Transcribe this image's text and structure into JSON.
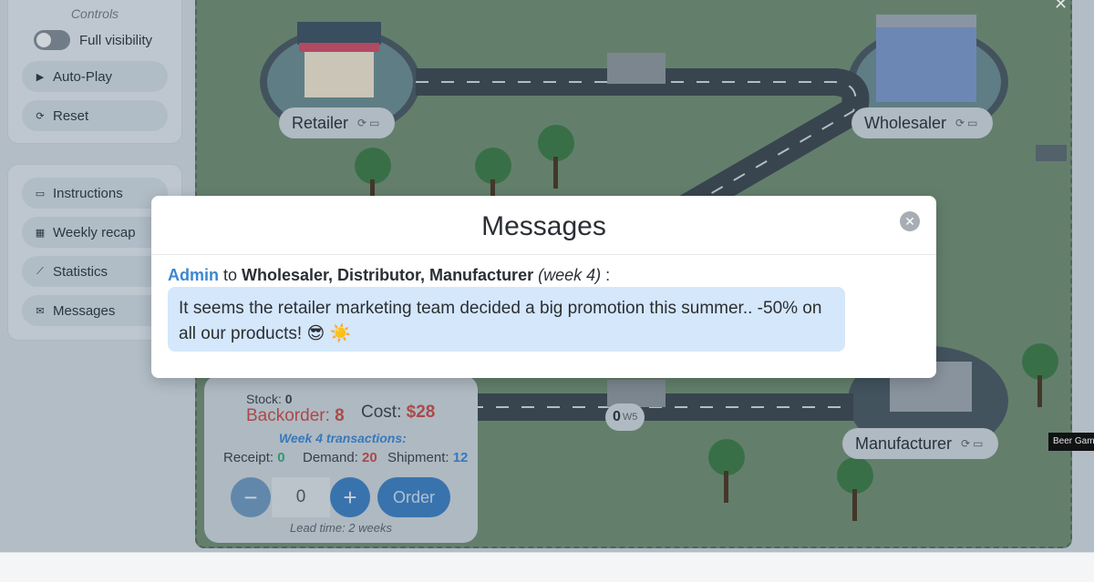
{
  "sidebar": {
    "controls_title": "Controls",
    "visibility_label": "Full visibility",
    "autoplay_label": "Auto-Play",
    "reset_label": "Reset",
    "nav": [
      {
        "label": "Instructions",
        "icon": "book-icon"
      },
      {
        "label": "Weekly recap",
        "icon": "calendar-icon"
      },
      {
        "label": "Statistics",
        "icon": "chart-icon"
      },
      {
        "label": "Messages",
        "icon": "envelope-icon"
      }
    ]
  },
  "board": {
    "labels": {
      "retailer": "Retailer",
      "wholesaler": "Wholesaler",
      "manufacturer": "Manufacturer"
    },
    "truck_badge": {
      "count": "0",
      "week": "W5"
    },
    "background": "#6f8d76"
  },
  "retailer_panel": {
    "stock_label": "Stock:",
    "stock_value": "0",
    "backorder_label": "Backorder:",
    "backorder_value": "8",
    "cost_label": "Cost:",
    "cost_value": "$28",
    "transactions_title": "Week 4 transactions:",
    "receipt_label": "Receipt:",
    "receipt_value": "0",
    "demand_label": "Demand:",
    "demand_value": "20",
    "shipment_label": "Shipment:",
    "shipment_value": "12",
    "minus": "−",
    "quantity": "0",
    "plus": "+",
    "order_label": "Order",
    "lead_time": "Lead time: 2 weeks"
  },
  "modal": {
    "title": "Messages",
    "close_symbol": "✕",
    "sender": "Admin",
    "to_word": " to ",
    "recipients": "Wholesaler, Distributor, Manufacturer",
    "week": "(week 4)",
    "colon": " :",
    "body": "It seems the retailer marketing team decided a big promotion this summer.. -50% on all our products! 😎 ☀️"
  },
  "window_close": "✕",
  "tooltip": "Beer Gam",
  "colors": {
    "accent": "#3c86d0",
    "danger": "#c0504d",
    "bubble": "#d5e7fa"
  }
}
